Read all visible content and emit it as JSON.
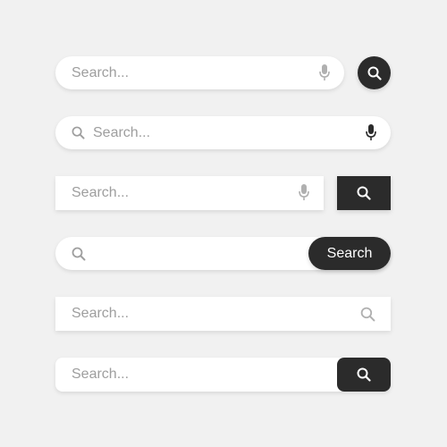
{
  "search_bars": [
    {
      "placeholder": "Search...",
      "icons": [
        "microphone-icon"
      ],
      "button_icon": "search-icon"
    },
    {
      "placeholder": "Search...",
      "icons": [
        "search-icon",
        "microphone-icon"
      ]
    },
    {
      "placeholder": "Search...",
      "icons": [
        "microphone-icon"
      ],
      "button_icon": "search-icon"
    },
    {
      "placeholder": "",
      "icons": [
        "search-icon"
      ],
      "button_label": "Search"
    },
    {
      "placeholder": "Search...",
      "icons": [
        "search-icon"
      ]
    },
    {
      "placeholder": "Search...",
      "button_icon": "search-icon"
    }
  ],
  "colors": {
    "background": "#f1f1f1",
    "field": "#ffffff",
    "button": "#2b2b2b",
    "placeholder": "#9e9e9e",
    "icon_light": "#b0b0b0",
    "icon_dark": "#2b2b2b"
  }
}
